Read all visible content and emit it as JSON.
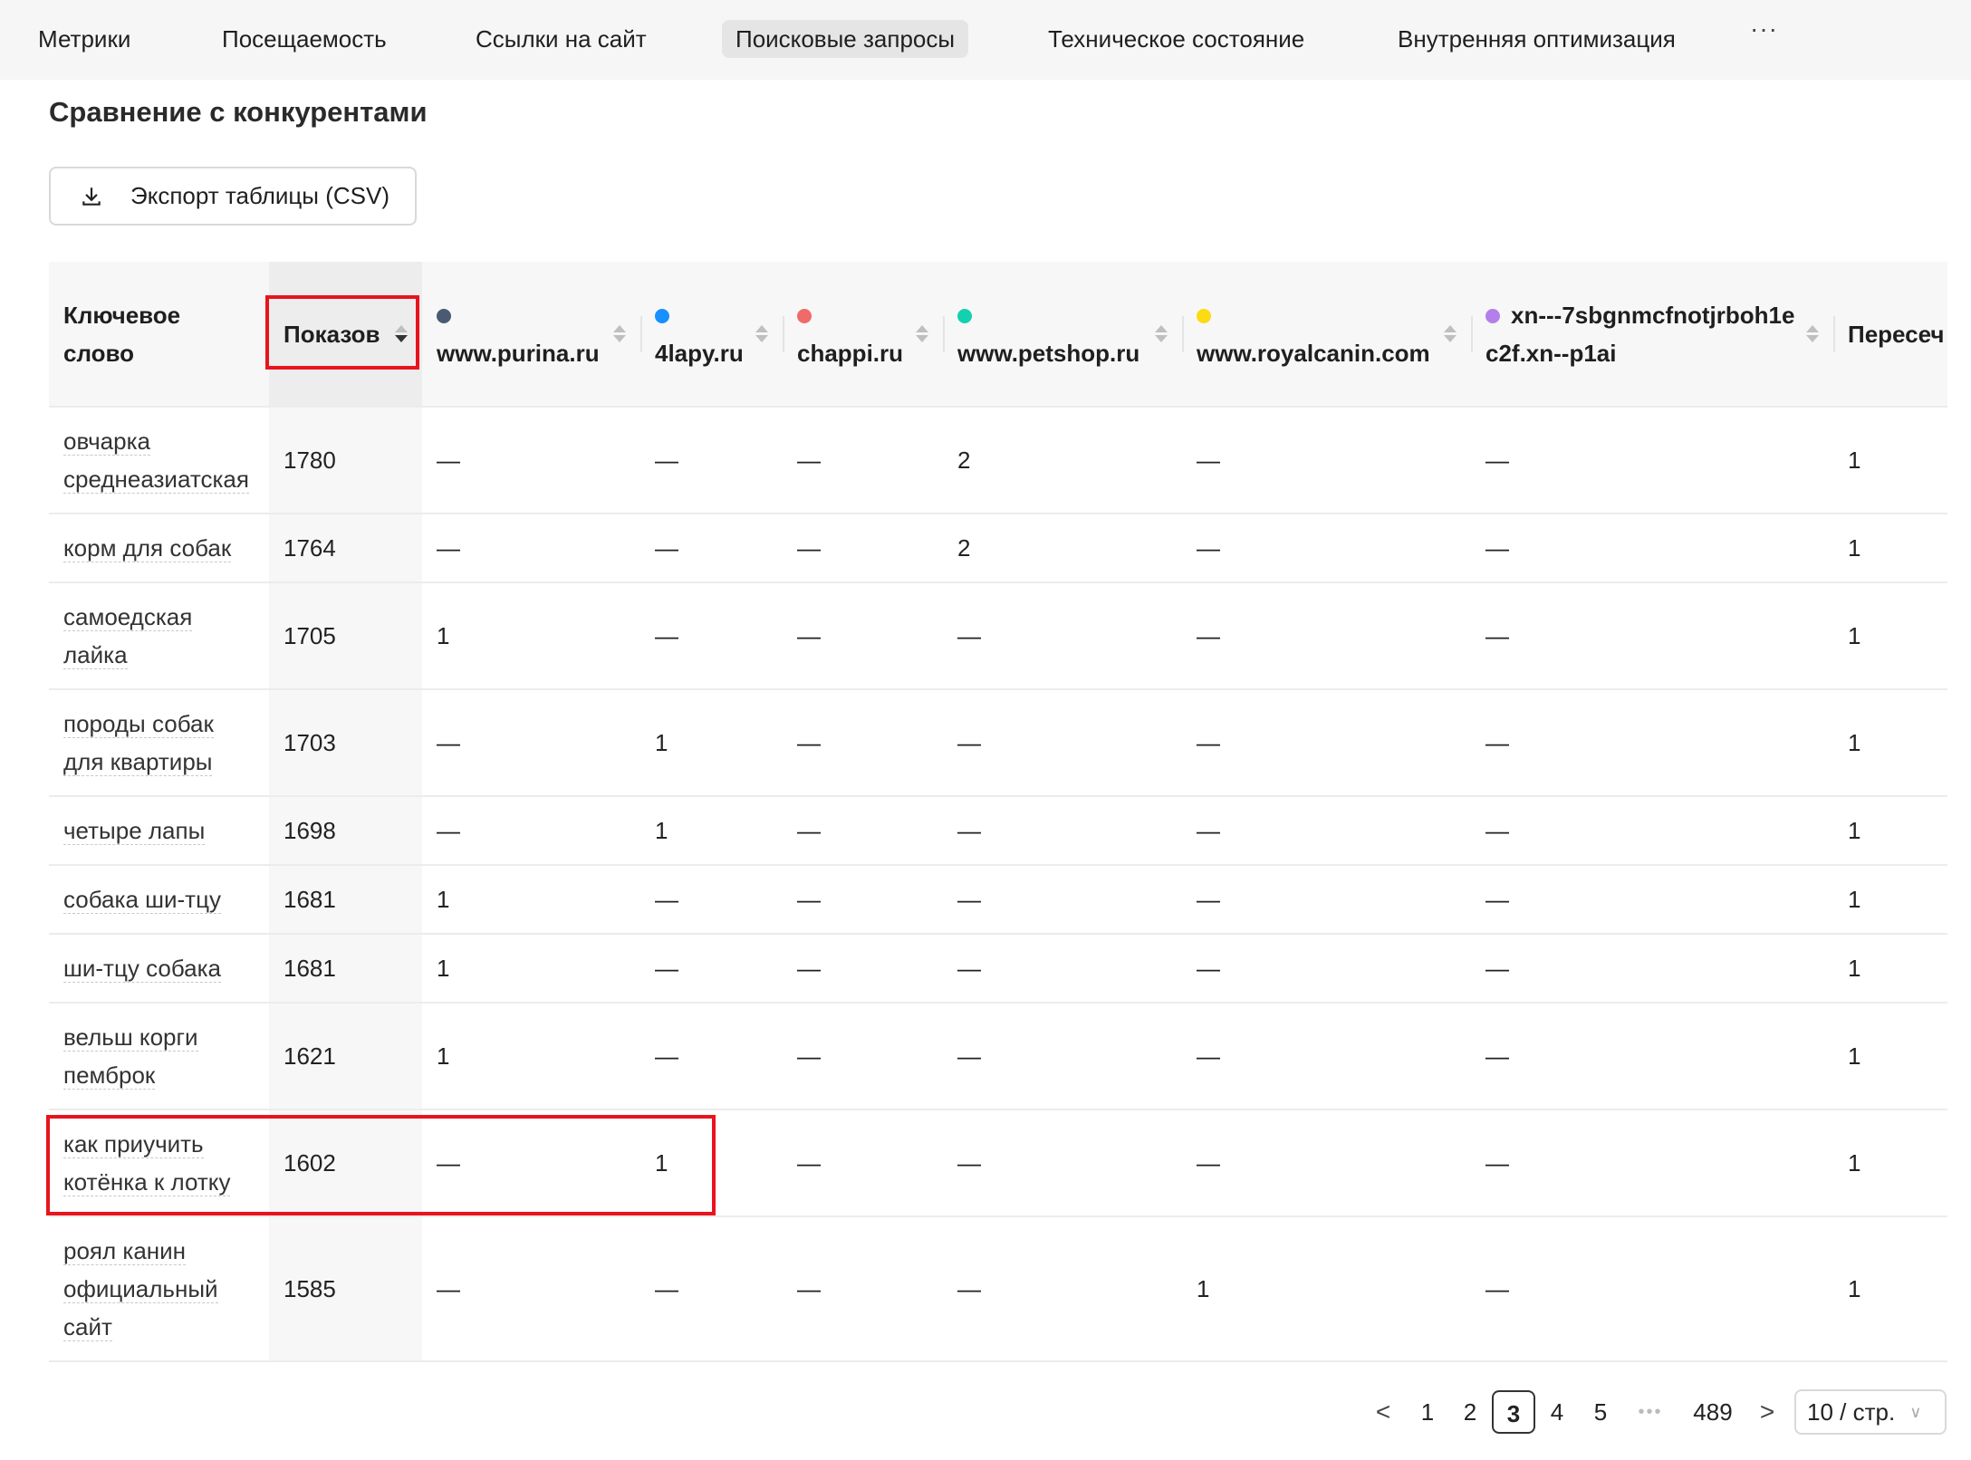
{
  "nav": {
    "tabs": [
      {
        "label": "Метрики"
      },
      {
        "label": "Посещаемость"
      },
      {
        "label": "Ссылки на сайт"
      },
      {
        "label": "Поисковые запросы",
        "active": true
      },
      {
        "label": "Техническое состояние"
      },
      {
        "label": "Внутренняя оптимизация"
      }
    ],
    "more": "···"
  },
  "section": {
    "title": "Сравнение с конкурентами"
  },
  "export": {
    "label": "Экспорт таблицы (CSV)",
    "icon": "download-icon"
  },
  "table": {
    "columns": [
      {
        "label": "Ключевое слово"
      },
      {
        "label": "Показов",
        "sorted": "descend"
      },
      {
        "label": "www.purina.ru",
        "color": "#4a5a72"
      },
      {
        "label": "4lapy.ru",
        "color": "#1890ff"
      },
      {
        "label": "chappi.ru",
        "color": "#f06a6a"
      },
      {
        "label": "www.petshop.ru",
        "color": "#13d1b0"
      },
      {
        "label": "www.royalcanin.com",
        "color": "#fadb14"
      },
      {
        "label": "xn---7sbgnmcfnotjrboh1ec2f.xn--p1ai",
        "color": "#b37feb"
      },
      {
        "label": "Пересеч"
      }
    ],
    "rows": [
      {
        "keyword": "овчарка среднеазиатская",
        "shows": "1780",
        "cells": [
          "—",
          "—",
          "—",
          "2",
          "—",
          "—",
          "1"
        ]
      },
      {
        "keyword": "корм для собак",
        "shows": "1764",
        "cells": [
          "—",
          "—",
          "—",
          "2",
          "—",
          "—",
          "1"
        ]
      },
      {
        "keyword": "самоедская лайка",
        "shows": "1705",
        "cells": [
          "1",
          "—",
          "—",
          "—",
          "—",
          "—",
          "1"
        ]
      },
      {
        "keyword": "породы собак для квартиры",
        "shows": "1703",
        "cells": [
          "—",
          "1",
          "—",
          "—",
          "—",
          "—",
          "1"
        ]
      },
      {
        "keyword": "четыре лапы",
        "shows": "1698",
        "cells": [
          "—",
          "1",
          "—",
          "—",
          "—",
          "—",
          "1"
        ]
      },
      {
        "keyword": "собака ши-тцу",
        "shows": "1681",
        "cells": [
          "1",
          "—",
          "—",
          "—",
          "—",
          "—",
          "1"
        ]
      },
      {
        "keyword": "ши-тцу собака",
        "shows": "1681",
        "cells": [
          "1",
          "—",
          "—",
          "—",
          "—",
          "—",
          "1"
        ]
      },
      {
        "keyword": "вельш корги пемброк",
        "shows": "1621",
        "cells": [
          "1",
          "—",
          "—",
          "—",
          "—",
          "—",
          "1"
        ]
      },
      {
        "keyword": "как приучить котёнка к лотку",
        "shows": "1602",
        "cells": [
          "—",
          "1",
          "—",
          "—",
          "—",
          "—",
          "1"
        ]
      },
      {
        "keyword": "роял канин официальный сайт",
        "shows": "1585",
        "cells": [
          "—",
          "—",
          "—",
          "—",
          "1",
          "—",
          "1"
        ]
      }
    ]
  },
  "pagination": {
    "prev": "<",
    "next": ">",
    "pages": [
      "1",
      "2",
      "3",
      "4",
      "5"
    ],
    "current": "3",
    "ellipsis": "•••",
    "last": "489",
    "page_size": "10 / стр."
  },
  "highlight_color": "#e8141d"
}
